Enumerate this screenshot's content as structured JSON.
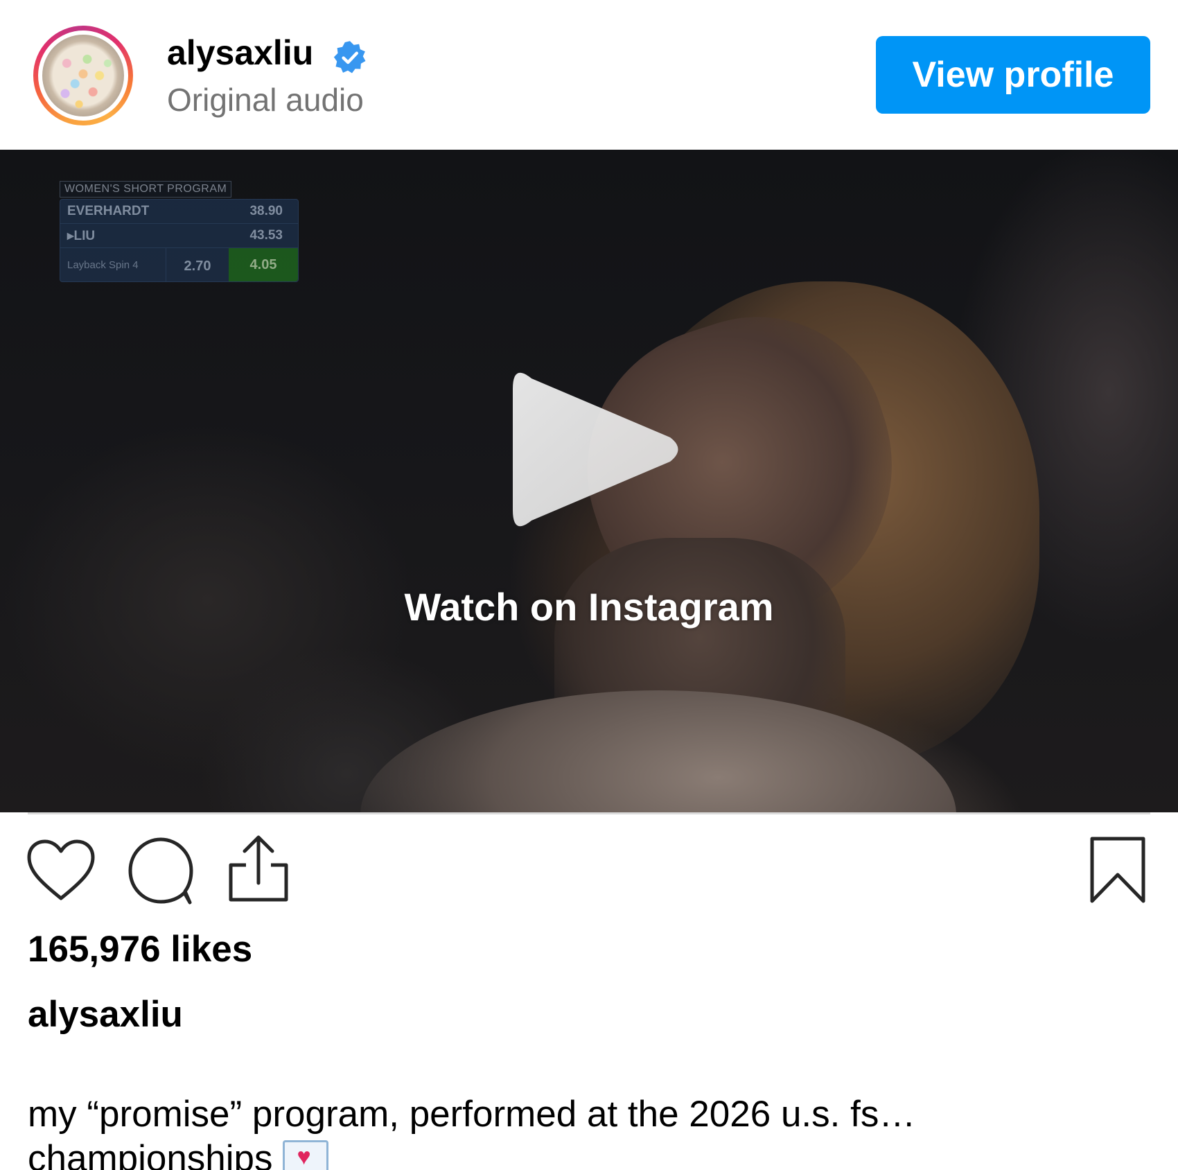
{
  "header": {
    "username": "alysaxliu",
    "verified": true,
    "subtitle": "Original audio",
    "view_profile_label": "View profile"
  },
  "media": {
    "scoreboard": {
      "title": "WOMEN'S SHORT PROGRAM",
      "rows": [
        {
          "name": "EVERHARDT",
          "score": "38.90"
        },
        {
          "name": "LIU",
          "score": "43.53"
        }
      ],
      "element": {
        "name": "Layback Spin 4",
        "base": "2.70",
        "total": "4.05"
      }
    },
    "watch_label": "Watch on Instagram",
    "play_icon": "play-icon"
  },
  "actions": {
    "icons": [
      "heart-icon",
      "comment-icon",
      "share-icon",
      "bookmark-icon"
    ]
  },
  "likes": "165,976 likes",
  "caption": {
    "username": "alysaxliu",
    "line1": "my “promise” program, performed at the 2026 u.s. fs…",
    "line2": "championships",
    "emoji": "love-letter-emoji"
  },
  "colors": {
    "accent": "#0095f6",
    "verified": "#3897f0",
    "subtitle": "#737373",
    "divider": "#dbdbdb"
  }
}
